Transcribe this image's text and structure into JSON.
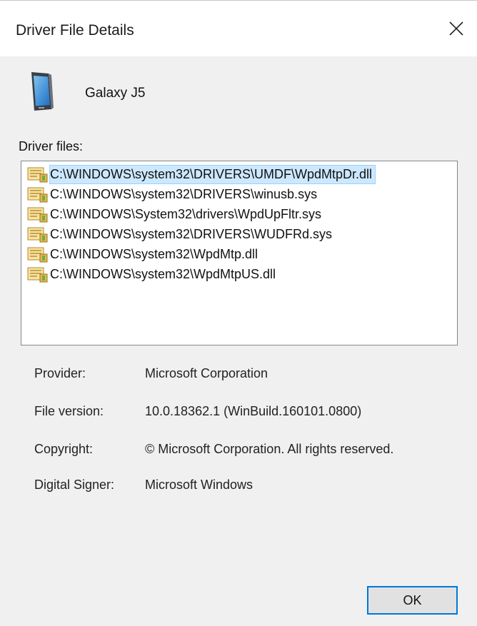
{
  "window": {
    "title": "Driver File Details"
  },
  "device": {
    "name": "Galaxy J5",
    "icon": "phone-icon"
  },
  "driver_files": {
    "label": "Driver files:",
    "selected_index": 0,
    "items": [
      "C:\\WINDOWS\\system32\\DRIVERS\\UMDF\\WpdMtpDr.dll",
      "C:\\WINDOWS\\system32\\DRIVERS\\winusb.sys",
      "C:\\WINDOWS\\System32\\drivers\\WpdUpFltr.sys",
      "C:\\WINDOWS\\system32\\DRIVERS\\WUDFRd.sys",
      "C:\\WINDOWS\\system32\\WpdMtp.dll",
      "C:\\WINDOWS\\system32\\WpdMtpUS.dll"
    ]
  },
  "details": {
    "provider_label": "Provider:",
    "provider_value": "Microsoft Corporation",
    "version_label": "File version:",
    "version_value": "10.0.18362.1 (WinBuild.160101.0800)",
    "copyright_label": "Copyright:",
    "copyright_value": "© Microsoft Corporation. All rights reserved.",
    "signer_label": "Digital Signer:",
    "signer_value": "Microsoft Windows"
  },
  "buttons": {
    "ok_label": "OK"
  },
  "colors": {
    "dialog_background": "#f0f0f0",
    "selection_background": "#cce8ff",
    "focus_border": "#0078d7"
  }
}
